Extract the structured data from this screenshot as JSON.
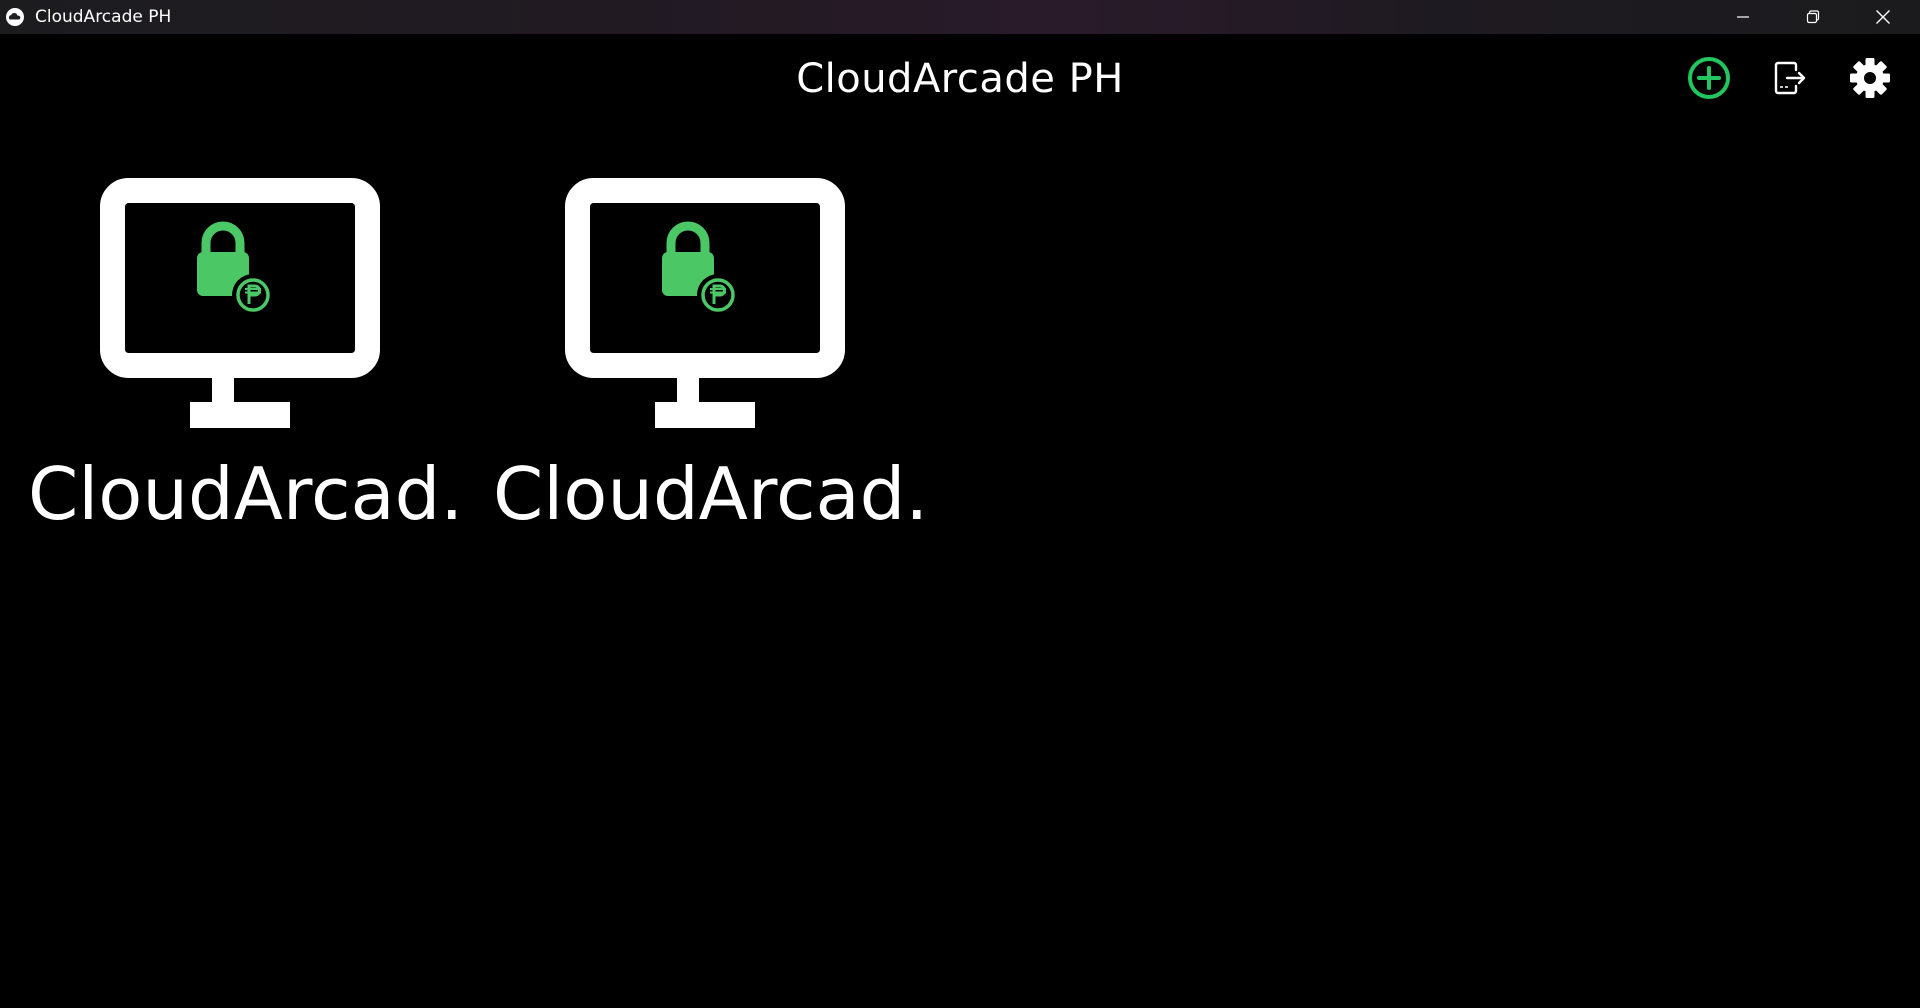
{
  "window": {
    "title": "CloudArcade PH",
    "app_icon": "cloud-icon",
    "controls": {
      "minimize_icon": "minimize-icon",
      "maximize_icon": "restore-icon",
      "close_icon": "close-icon"
    }
  },
  "header": {
    "title": "CloudArcade PH",
    "actions": [
      {
        "name": "add-machine",
        "icon": "plus-circle-icon",
        "color": "#22c55e"
      },
      {
        "name": "logout",
        "icon": "logout-icon",
        "color": "#ffffff"
      },
      {
        "name": "settings",
        "icon": "gear-icon",
        "color": "#ffffff"
      }
    ]
  },
  "machines": [
    {
      "label": "CloudArcad...",
      "icon": "locked-monitor-icon",
      "badge_icon": "peso-coin-icon"
    },
    {
      "label": "CloudArcad...",
      "icon": "locked-monitor-icon",
      "badge_icon": "peso-coin-icon"
    }
  ],
  "colors": {
    "background": "#000000",
    "accent": "#22c55e",
    "lock": "#4cc766",
    "text": "#ffffff"
  }
}
